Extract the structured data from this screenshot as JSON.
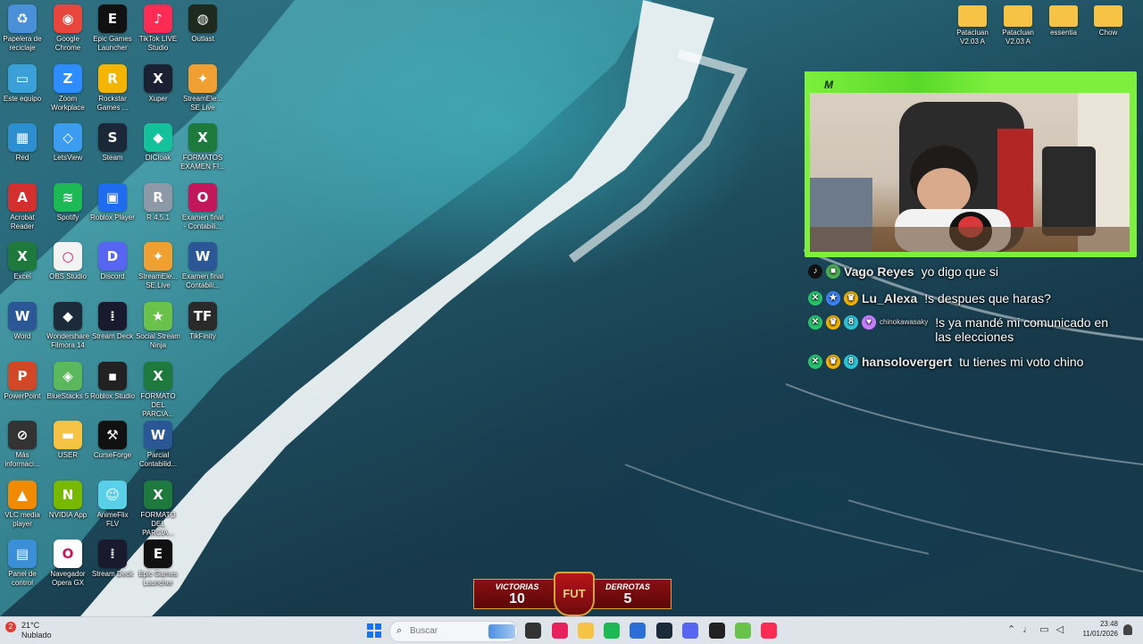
{
  "desktop": {
    "icons": [
      {
        "label": "Papelera de reciclaje",
        "icon": "recycle-bin-icon",
        "color": "#4a90d9",
        "glyph": "♻"
      },
      {
        "label": "Este equipo",
        "icon": "computer-icon",
        "color": "#3aa0d8",
        "glyph": "▭"
      },
      {
        "label": "Red",
        "icon": "network-icon",
        "color": "#2d8fd0",
        "glyph": "▦"
      },
      {
        "label": "Acrobat Reader",
        "icon": "pdf-icon",
        "color": "#d32f2f",
        "glyph": "A"
      },
      {
        "label": "Excel",
        "icon": "excel-icon",
        "color": "#1d7a3c",
        "glyph": "X"
      },
      {
        "label": "Word",
        "icon": "word-icon",
        "color": "#2b5797",
        "glyph": "W"
      },
      {
        "label": "PowerPoint",
        "icon": "powerpoint-icon",
        "color": "#d24726",
        "glyph": "P"
      },
      {
        "label": "Más informaci...",
        "icon": "info-icon",
        "color": "#333333",
        "glyph": "⊘"
      },
      {
        "label": "VLC media player",
        "icon": "vlc-icon",
        "color": "#f08a00",
        "glyph": "▲"
      },
      {
        "label": "Panel de control",
        "icon": "control-panel-icon",
        "color": "#3b8fd6",
        "glyph": "▤"
      },
      {
        "label": "Google Chrome",
        "icon": "chrome-icon",
        "color": "#e8453c",
        "glyph": "◉"
      },
      {
        "label": "Zoom Workplace",
        "icon": "zoom-icon",
        "color": "#2d8cff",
        "glyph": "Z"
      },
      {
        "label": "LetsView",
        "icon": "letsview-icon",
        "color": "#3b9cf0",
        "glyph": "◇"
      },
      {
        "label": "Spotify",
        "icon": "spotify-icon",
        "color": "#1db954",
        "glyph": "≋"
      },
      {
        "label": "OBS Studio",
        "icon": "obs-icon",
        "color": "#f3f3f3",
        "glyph": "○"
      },
      {
        "label": "Wondershare Filmora 14",
        "icon": "filmora-icon",
        "color": "#1b2b3a",
        "glyph": "◆"
      },
      {
        "label": "BlueStacks 5",
        "icon": "bluestacks-icon",
        "color": "#5cb85c",
        "glyph": "◈"
      },
      {
        "label": "USER",
        "icon": "folder-icon",
        "color": "#f6c344",
        "glyph": "▬"
      },
      {
        "label": "NVIDIA App",
        "icon": "nvidia-icon",
        "color": "#76b900",
        "glyph": "N"
      },
      {
        "label": "Navegador Opera GX",
        "icon": "opera-icon",
        "color": "#ffffff",
        "glyph": "O"
      },
      {
        "label": "Epic Games Launcher",
        "icon": "epic-icon",
        "color": "#111111",
        "glyph": "E"
      },
      {
        "label": "Rockstar Games ...",
        "icon": "rockstar-icon",
        "color": "#f4b400",
        "glyph": "R"
      },
      {
        "label": "Steam",
        "icon": "steam-icon",
        "color": "#1b2838",
        "glyph": "S"
      },
      {
        "label": "Roblox Player",
        "icon": "roblox-icon",
        "color": "#1f6cf0",
        "glyph": "▣"
      },
      {
        "label": "Discord",
        "icon": "discord-icon",
        "color": "#5865f2",
        "glyph": "D"
      },
      {
        "label": "Stream Deck",
        "icon": "streamdeck-icon",
        "color": "#1a1a2e",
        "glyph": "⁞"
      },
      {
        "label": "Roblox Studio",
        "icon": "roblox-studio-icon",
        "color": "#222222",
        "glyph": "▪"
      },
      {
        "label": "CurseForge",
        "icon": "curseforge-icon",
        "color": "#111111",
        "glyph": "⚒"
      },
      {
        "label": "AnimeFlix FLV",
        "icon": "animeflix-icon",
        "color": "#5ad0e8",
        "glyph": "☺"
      },
      {
        "label": "Stream Deck",
        "icon": "streamdeck-icon",
        "color": "#1a1a2e",
        "glyph": "⁞"
      },
      {
        "label": "TikTok LIVE Studio",
        "icon": "tiktok-icon",
        "color": "#fe2c55",
        "glyph": "♪"
      },
      {
        "label": "Xuper",
        "icon": "xuper-icon",
        "color": "#1c2033",
        "glyph": "X"
      },
      {
        "label": "DICloak",
        "icon": "dicloak-icon",
        "color": "#13c29b",
        "glyph": "◆"
      },
      {
        "label": "R 4.5.1",
        "icon": "r-lang-icon",
        "color": "#8d99a6",
        "glyph": "R"
      },
      {
        "label": "StreamEle... SE.Live",
        "icon": "streamelements-icon",
        "color": "#f0a030",
        "glyph": "✦"
      },
      {
        "label": "Social Stream Ninja",
        "icon": "socialstream-icon",
        "color": "#6bc24a",
        "glyph": "★"
      },
      {
        "label": "FORMATO DEL PARCIA...",
        "icon": "excel-file-icon",
        "color": "#1d7a3c",
        "glyph": "X"
      },
      {
        "label": "Parcial Contabilid...",
        "icon": "word-file-icon",
        "color": "#2b5797",
        "glyph": "W"
      },
      {
        "label": "FORMATO DEL PARCIA...",
        "icon": "excel-file-icon",
        "color": "#1d7a3c",
        "glyph": "X"
      },
      {
        "label": "Epic Games Launcher",
        "icon": "epic-icon",
        "color": "#111111",
        "glyph": "E"
      },
      {
        "label": "Outlast",
        "icon": "outlast-icon",
        "color": "#1e2a1e",
        "glyph": "◍"
      },
      {
        "label": "StreamEle... SE.Live",
        "icon": "streamelements-icon",
        "color": "#f0a030",
        "glyph": "✦"
      },
      {
        "label": "FORMATOS EXAMEN FI...",
        "icon": "excel-file-icon",
        "color": "#1d7a3c",
        "glyph": "X"
      },
      {
        "label": "Examen final - Contabili...",
        "icon": "opera-file-icon",
        "color": "#c2185b",
        "glyph": "O"
      },
      {
        "label": "Examen final Contabili...",
        "icon": "word-file-icon",
        "color": "#2b5797",
        "glyph": "W"
      },
      {
        "label": "TikFinity",
        "icon": "tikfinity-icon",
        "color": "#2a2a2a",
        "glyph": "TF"
      }
    ],
    "right_icons": [
      {
        "label": "Patacluan V2.03 A",
        "icon": "folder-icon"
      },
      {
        "label": "Patacluan V2.03 A",
        "icon": "folder-zip-icon"
      },
      {
        "label": "essentia",
        "icon": "folder-icon"
      },
      {
        "label": "Chow",
        "icon": "folder-icon"
      }
    ]
  },
  "overlay": {
    "cam_label": "M",
    "chat": [
      {
        "badges": [
          "tiktok-icon",
          "gift-icon"
        ],
        "user": "Vago Reyes",
        "msg": "yo digo que si"
      },
      {
        "badges": [
          "moderator-icon",
          "star-icon",
          "crown-icon"
        ],
        "user": "Lu_Alexa",
        "msg": "!s despues que haras?"
      },
      {
        "badges": [
          "moderator-icon",
          "crown-icon",
          "level-icon",
          "heart-icon"
        ],
        "user": "chinokawasaky",
        "msg": "!s ya mandé mi comunicado en las elecciones"
      },
      {
        "badges": [
          "moderator-icon",
          "crown-icon",
          "level-icon"
        ],
        "user": "hansolovergert",
        "msg": "tu tienes mi voto chino"
      }
    ],
    "score": {
      "wins_label": "VICTORIAS",
      "wins": "10",
      "badge": "FUT",
      "losses_label": "DERROTAS",
      "losses": "5"
    }
  },
  "taskbar": {
    "weather_temp": "21°C",
    "weather_desc": "Nublado",
    "search_placeholder": "Buscar",
    "time": "23:48",
    "date": "11/01/2026",
    "apps": [
      {
        "icon": "windows-start-icon",
        "color": "#1a73e8"
      },
      {
        "icon": "task-view-icon",
        "color": "#333333"
      },
      {
        "icon": "opera-gx-icon",
        "color": "#e8205c"
      },
      {
        "icon": "file-explorer-icon",
        "color": "#f6c344"
      },
      {
        "icon": "spotify-icon",
        "color": "#1db954"
      },
      {
        "icon": "microsoft-store-icon",
        "color": "#2b6fd6"
      },
      {
        "icon": "filmora-icon",
        "color": "#1b2b3a"
      },
      {
        "icon": "discord-icon",
        "color": "#5865f2"
      },
      {
        "icon": "obs-icon",
        "color": "#222222"
      },
      {
        "icon": "social-stream-icon",
        "color": "#6bc24a"
      },
      {
        "icon": "tiktok-live-icon",
        "color": "#fe2c55"
      }
    ]
  }
}
